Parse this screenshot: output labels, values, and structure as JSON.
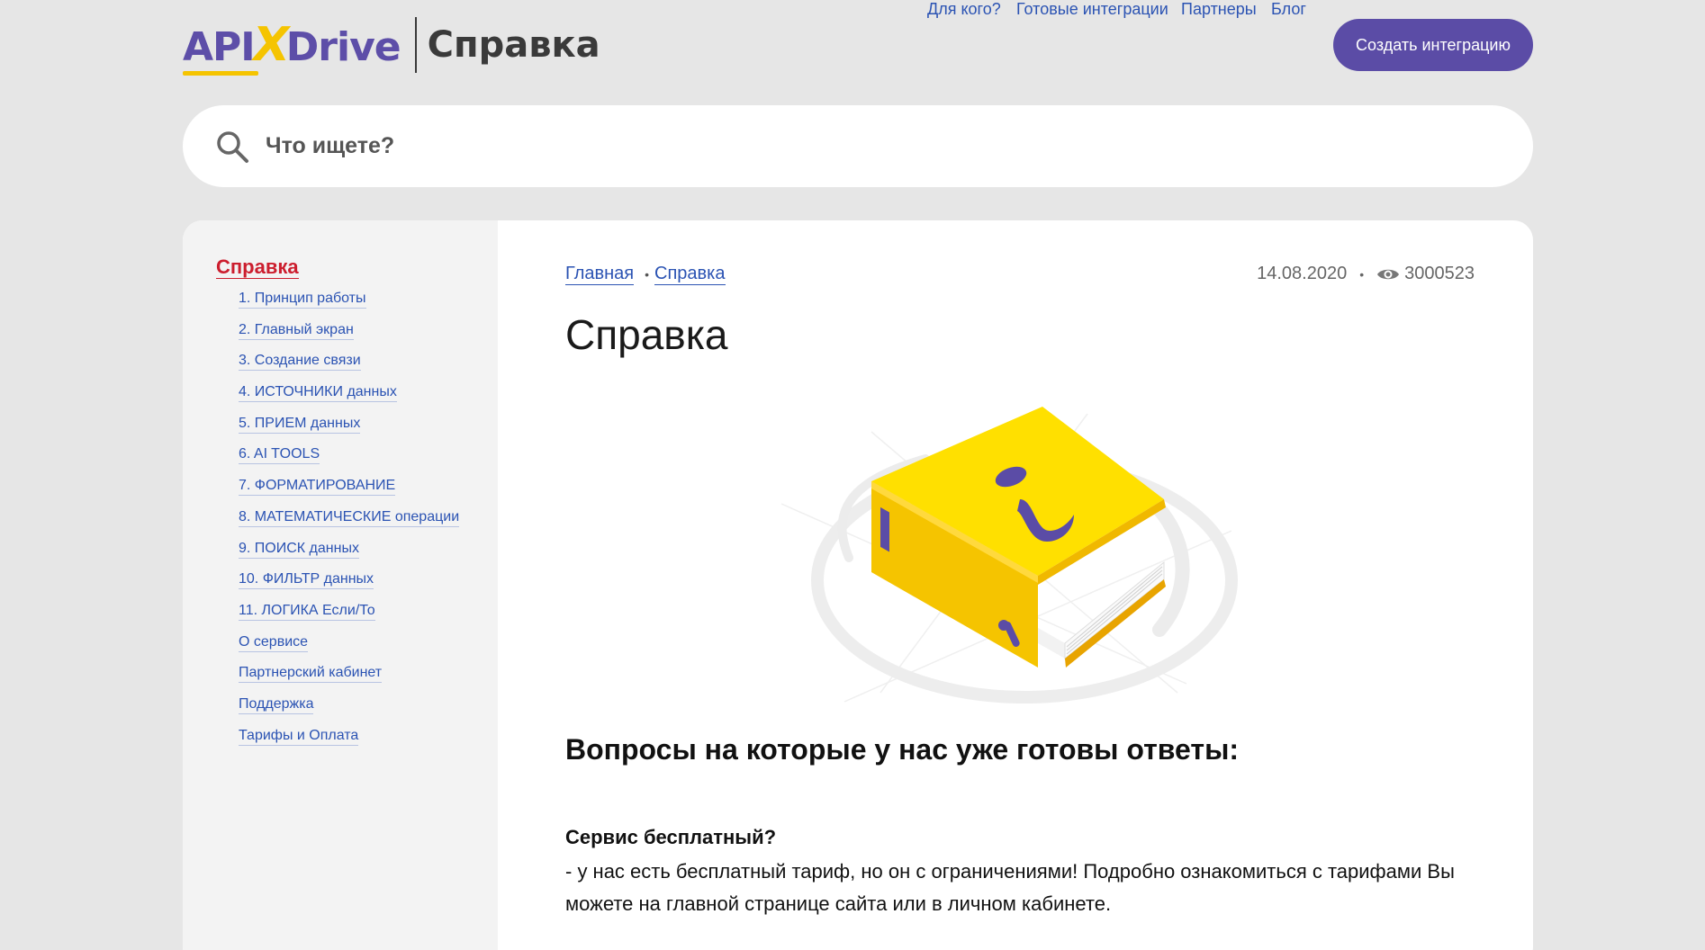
{
  "header": {
    "logo": {
      "part1": "API",
      "part2": "X",
      "part3": "Drive",
      "subtitle": "Справка"
    },
    "nav": [
      {
        "label": "Для кого?"
      },
      {
        "label": "Готовые интеграции"
      },
      {
        "label": "Партнеры"
      },
      {
        "label": "Блог"
      }
    ],
    "cta_label": "Создать интеграцию"
  },
  "search": {
    "placeholder": "Что ищете?",
    "icon": "search-icon"
  },
  "sidebar": {
    "title": "Справка",
    "items": [
      {
        "label": "1. Принцип работы"
      },
      {
        "label": "2. Главный экран"
      },
      {
        "label": "3. Создание связи"
      },
      {
        "label": "4. ИСТОЧНИКИ данных"
      },
      {
        "label": "5. ПРИЕМ данных"
      },
      {
        "label": "6. AI TOOLS"
      },
      {
        "label": "7. ФОРМАТИРОВАНИЕ"
      },
      {
        "label": "8. МАТЕМАТИЧЕСКИЕ операции"
      },
      {
        "label": "9. ПОИСК данных"
      },
      {
        "label": "10. ФИЛЬТР данных"
      },
      {
        "label": "11. ЛОГИКА Если/То"
      },
      {
        "label": "О сервисе"
      },
      {
        "label": "Партнерский кабинет"
      },
      {
        "label": "Поддержка"
      },
      {
        "label": "Тарифы и Оплата"
      }
    ]
  },
  "main": {
    "breadcrumb": [
      "Главная",
      "Справка"
    ],
    "breadcrumb_separator": "•",
    "date": "14.08.2020",
    "meta_separator": "•",
    "views": "3000523",
    "title": "Справка",
    "section_heading": "Вопросы на которые у нас уже готовы ответы:",
    "faq": [
      {
        "question": "Сервис бесплатный?",
        "answer": "- у нас есть бесплатный тариф, но он с ограничениями! Подробно ознакомиться с тарифами Вы можете на главной странице сайта или в личном кабинете."
      }
    ]
  },
  "colors": {
    "brand_purple": "#5b4ca6",
    "brand_yellow": "#f5c400",
    "link_blue": "#2b53b3",
    "active_red": "#cc1e2e",
    "page_bg": "#e6e6e6"
  }
}
